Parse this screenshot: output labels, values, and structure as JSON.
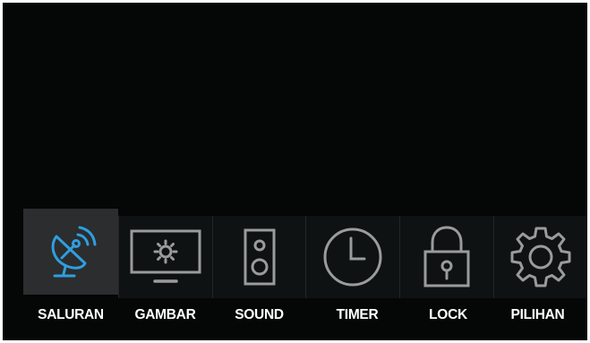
{
  "menu": {
    "items": [
      {
        "label": "SALURAN",
        "icon": "satellite-dish-icon",
        "selected": true
      },
      {
        "label": "GAMBAR",
        "icon": "monitor-brightness-icon",
        "selected": false
      },
      {
        "label": "SOUND",
        "icon": "speaker-icon",
        "selected": false
      },
      {
        "label": "TIMER",
        "icon": "clock-icon",
        "selected": false
      },
      {
        "label": "LOCK",
        "icon": "padlock-icon",
        "selected": false
      },
      {
        "label": "PILIHAN",
        "icon": "gear-icon",
        "selected": false
      }
    ]
  },
  "colors": {
    "screen_background": "#050606",
    "selected_tile": "#2b2d2e",
    "tile": "#0f1212",
    "selected_icon": "#2f9ee0",
    "icon": "#9a9c9c",
    "label": "#ffffff"
  }
}
